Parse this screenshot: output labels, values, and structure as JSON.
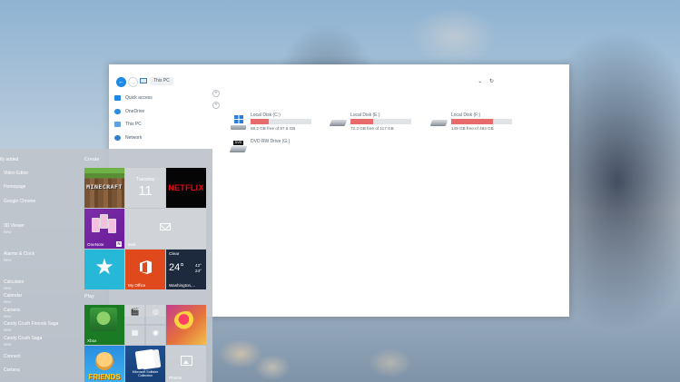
{
  "explorer": {
    "address": "This PC",
    "sidebar": [
      "Quick access",
      "OneDrive",
      "This PC",
      "Network"
    ],
    "drives": [
      {
        "name": "Local Disk (C:)",
        "free": "68.2 GB free of 97.6 GB",
        "used_fraction": 0.3,
        "icon": "windows-drive-icon"
      },
      {
        "name": "Local Disk (E:)",
        "free": "72.3 GB free of 117 GB",
        "used_fraction": 0.38,
        "icon": "hard-drive-icon"
      },
      {
        "name": "Local Disk (F:)",
        "free": "149 GB free of 483 GB",
        "used_fraction": 0.69,
        "icon": "hard-drive-icon"
      },
      {
        "name": "DVD RW Drive (G:)",
        "icon": "dvd-drive-icon",
        "dvd_label": "DVD"
      }
    ],
    "icons": {
      "refresh": "↻",
      "chevron": "⌄",
      "back": "←",
      "forward": "→",
      "plus": "+"
    }
  },
  "start": {
    "recently_added": "tly added",
    "apps": [
      {
        "label": "Video Editor"
      },
      {
        "label": "Homepage"
      },
      {
        "label": "Google Chrome"
      },
      {
        "label": "3D Viewer",
        "sub": "New"
      },
      {
        "label": "Alarms & Clock",
        "sub": "New"
      },
      {
        "label": "Calculator",
        "sub": "New"
      },
      {
        "label": "Calendar",
        "sub": "New"
      },
      {
        "label": "Camera",
        "sub": "New"
      },
      {
        "label": "Candy Crush Friends Saga",
        "sub": "New"
      },
      {
        "label": "Candy Crush Saga",
        "sub": "New"
      },
      {
        "label": "Connect"
      },
      {
        "label": "Cortana"
      }
    ],
    "sections": {
      "create": "Create",
      "play": "Play"
    },
    "tiles": {
      "minecraft": "MINECRAFT",
      "calendar_day": "Tuesday",
      "calendar_num": "11",
      "netflix": "NETFLIX",
      "onenote": "OneNote",
      "onenote_badge": "N",
      "mail": "Mail",
      "store_icon": "★",
      "office": "My Office",
      "weather_cond": "Clear",
      "weather_temp": "24°",
      "weather_hi": "42°",
      "weather_lo": "24°",
      "weather_city": "Washington,...",
      "xbox": "Xbox",
      "friends": "FRIENDS",
      "solitaire": "Microsoft Solitaire Collection",
      "photos": "Photos",
      "small_icons": [
        "🎬",
        "◎",
        "▦",
        "◉"
      ]
    }
  },
  "colors": {
    "accent": "#1e88e5",
    "disk_bar": "#e86b6b",
    "netflix": "#e50914",
    "office": "#e0491b",
    "store": "#27b8d8",
    "onenote": "#7b2fa6"
  }
}
